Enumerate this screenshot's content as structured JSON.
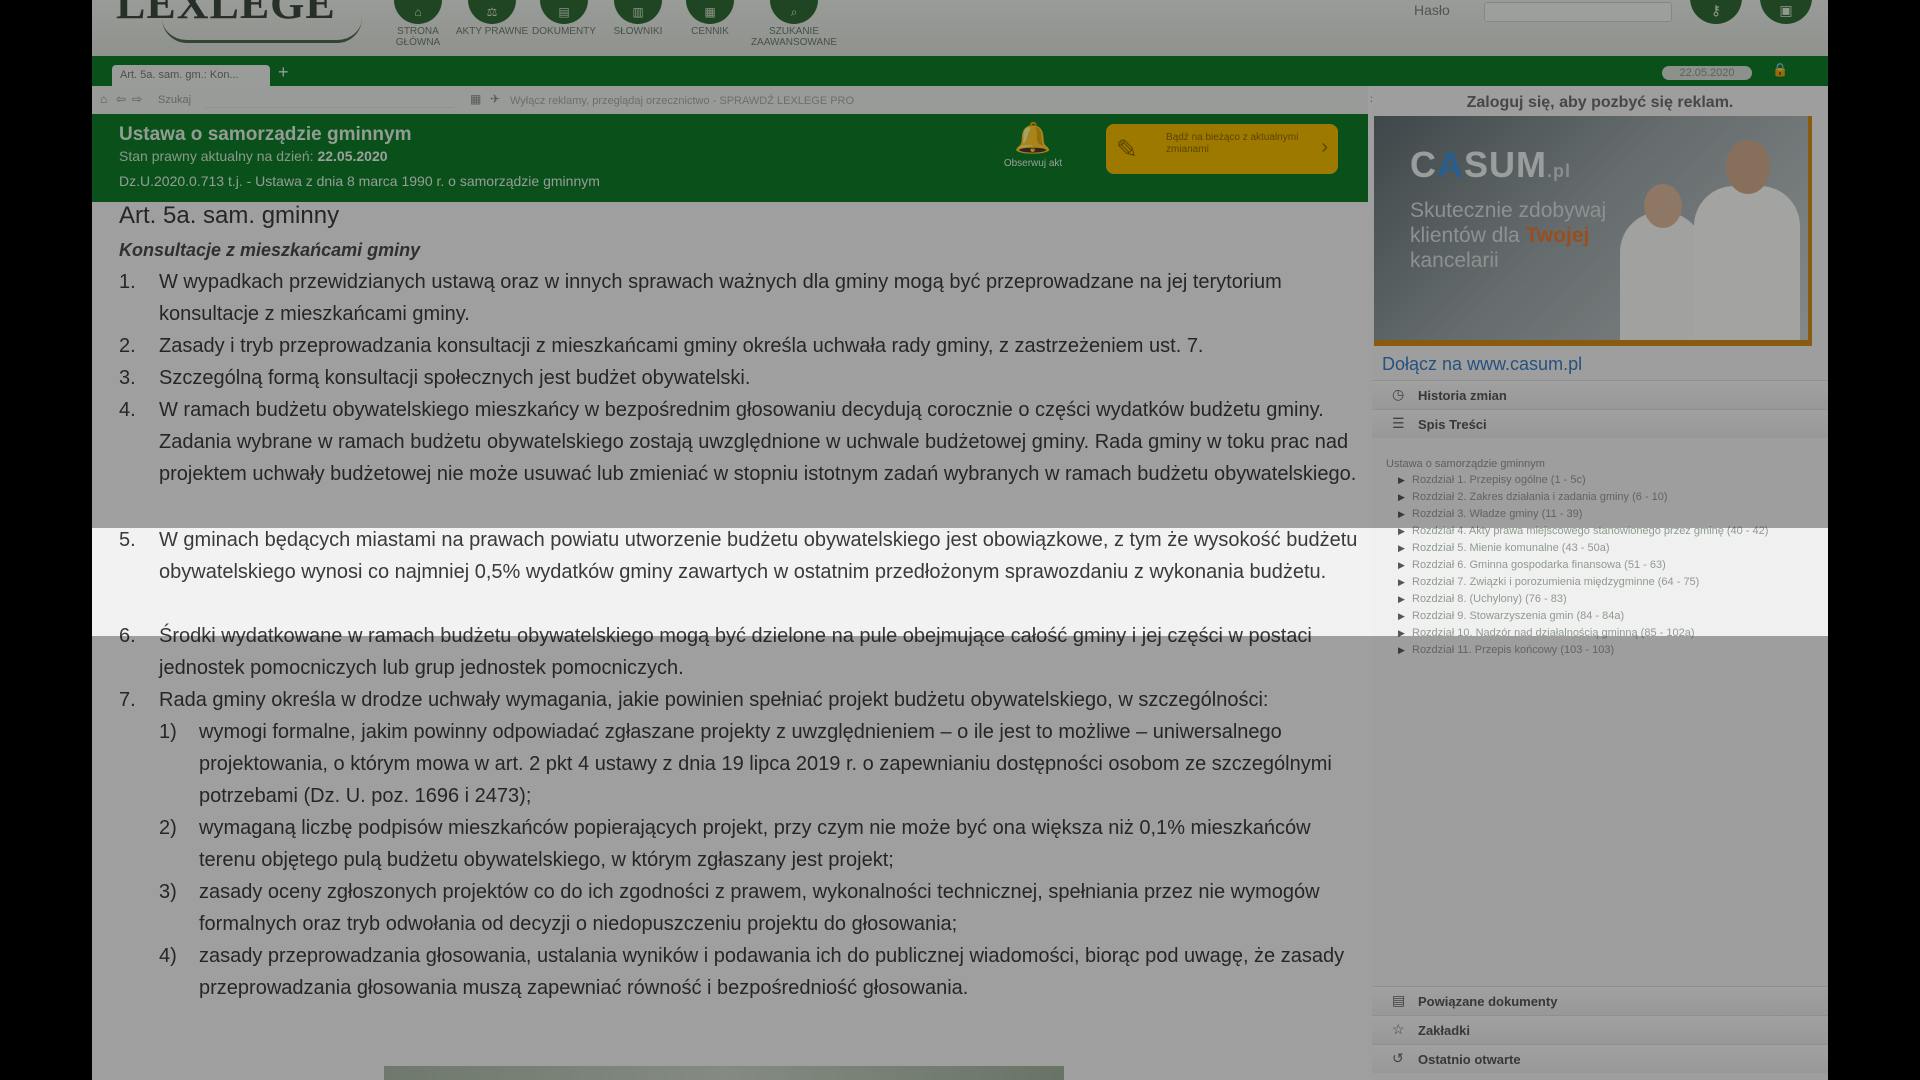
{
  "header": {
    "logo": "LEXLEGE",
    "nav": [
      {
        "label": "STRONA GŁÓWNA",
        "icon": "home-icon"
      },
      {
        "label": "AKTY PRAWNE",
        "icon": "scale-icon"
      },
      {
        "label": "DOKUMENTY",
        "icon": "document-icon"
      },
      {
        "label": "SŁOWNIKI",
        "icon": "book-icon"
      },
      {
        "label": "CENNIK",
        "icon": "price-icon"
      },
      {
        "label": "SZUKANIE ZAAWANSOWANE",
        "icon": "magnifier-icon"
      }
    ],
    "password_label": "Hasło",
    "login_button": "login-key-icon",
    "register_button": "register-icon"
  },
  "tabs": {
    "active": "Art. 5a. sam. gm.: Kon...",
    "add": "+",
    "date": "22.05.2020"
  },
  "toolbar": {
    "search_label": "Szukaj",
    "promo": "Wyłącz reklamy, przeglądaj orzecznictwo - SPRAWDŹ LEXLEGE PRO"
  },
  "act": {
    "title": "Ustawa o samorządzie gminnym",
    "status_prefix": "Stan prawny aktualny na dzień:",
    "status_date": "22.05.2020",
    "reference": "Dz.U.2020.0.713 t.j. - Ustawa z dnia 8 marca 1990 r. o samorządzie gminnym",
    "observe_label": "Obserwuj akt",
    "promo_text": "Bądź na bieżąco z aktualnymi zmianami"
  },
  "article": {
    "title": "Art. 5a. sam. gminny",
    "subtitle": "Konsultacje z mieszkańcami gminy",
    "paragraphs": [
      {
        "num": "1.",
        "text": "W wypadkach przewidzianych ustawą oraz w innych sprawach ważnych dla gminy mogą być przeprowadzane na jej terytorium konsultacje z mieszkańcami gminy."
      },
      {
        "num": "2.",
        "text": "Zasady i tryb przeprowadzania konsultacji z mieszkańcami gminy określa uchwała rady gminy, z zastrzeżeniem ust. 7."
      },
      {
        "num": "3.",
        "text": "Szczególną formą konsultacji społecznych jest budżet obywatelski."
      },
      {
        "num": "4.",
        "text": "W ramach budżetu obywatelskiego mieszkańcy w bezpośrednim głosowaniu decydują corocznie o części wydatków budżetu gminy. Zadania wybrane w ramach budżetu obywatelskiego zostają uwzględnione w uchwale budżetowej gminy. Rada gminy w toku prac nad projektem uchwały budżetowej nie może usuwać lub zmieniać w stopniu istotnym zadań wybranych w ramach budżetu obywatelskiego."
      },
      {
        "num": "5.",
        "text": "W gminach będących miastami na prawach powiatu utworzenie budżetu obywatelskiego jest obowiązkowe, z tym że wysokość budżetu obywatelskiego wynosi co najmniej 0,5% wydatków gminy zawartych w ostatnim przedłożonym sprawozdaniu z wykonania budżetu."
      },
      {
        "num": "6.",
        "text": "Środki wydatkowane w ramach budżetu obywatelskiego mogą być dzielone na pule obejmujące całość gminy i jej części w postaci jednostek pomocniczych lub grup jednostek pomocniczych."
      },
      {
        "num": "7.",
        "text": "Rada gminy określa w drodze uchwały wymagania, jakie powinien spełniać projekt budżetu obywatelskiego, w szczególności:"
      }
    ],
    "subpoints": [
      {
        "num": "1)",
        "text": "wymogi formalne, jakim powinny odpowiadać zgłaszane projekty z uwzględnieniem – o ile jest to możliwe – uniwersalnego projektowania, o którym mowa w art. 2 pkt 4 ustawy z dnia 19 lipca 2019 r. o zapewnianiu dostępności osobom ze szczególnymi potrzebami (Dz. U. poz. 1696 i 2473);"
      },
      {
        "num": "2)",
        "text": "wymaganą liczbę podpisów mieszkańców popierających projekt, przy czym nie może być ona większa niż 0,1% mieszkańców terenu objętego pulą budżetu obywatelskiego, w którym zgłaszany jest projekt;"
      },
      {
        "num": "3)",
        "text": "zasady oceny zgłoszonych projektów co do ich zgodności z prawem, wykonalności technicznej, spełniania przez nie wymogów formalnych oraz tryb odwołania od decyzji o niedopuszczeniu projektu do głosowania;"
      },
      {
        "num": "4)",
        "text": "zasady przeprowadzania głosowania, ustalania wyników i podawania ich do publicznej wiadomości, biorąc pod uwagę, że zasady przeprowadzania głosowania muszą zapewniać równość i bezpośredniość głosowania."
      }
    ]
  },
  "sidebar": {
    "login_ad": "Zaloguj się, aby pozbyć się reklam.",
    "ad_logo_c": "C",
    "ad_logo_a": "A",
    "ad_logo_rest": "SUM",
    "ad_logo_tld": ".pl",
    "ad_tag_1": "Skutecznie zdobywaj klientów dla",
    "ad_tag_bold": "Twojej",
    "ad_tag_2": "kancelarii",
    "ad_link": "Dołącz na www.casum.pl",
    "sections": {
      "history": "Historia zmian",
      "toc": "Spis Treści",
      "related": "Powiązane dokumenty",
      "bookmarks": "Zakładki",
      "recent": "Ostatnio otwarte"
    },
    "toc_root": "Ustawa o samorządzie gminnym",
    "toc_items": [
      "Rozdział 1. Przepisy ogólne (1 - 5c)",
      "Rozdział 2. Zakres działania i zadania gminy (6 - 10)",
      "Rozdział 3. Władze gminy (11 - 39)",
      "Rozdział 4. Akty prawa miejscowego stanowionego przez gminę (40 - 42)",
      "Rozdział 5. Mienie komunalne (43 - 50a)",
      "Rozdział 6. Gminna gospodarka finansowa (51 - 63)",
      "Rozdział 7. Związki i porozumienia międzygminne (64 - 75)",
      "Rozdział 8. (Uchylony) (76 - 83)",
      "Rozdział 9. Stowarzyszenia gmin (84 - 84a)",
      "Rozdział 10. Nadzór nad działalnością gminną (85 - 102a)",
      "Rozdział 11. Przepis końcowy (103 - 103)"
    ]
  },
  "colors": {
    "brand_green": "#0f7a2a",
    "accent_yellow": "#f0b800",
    "link_blue": "#3a7cc2"
  }
}
